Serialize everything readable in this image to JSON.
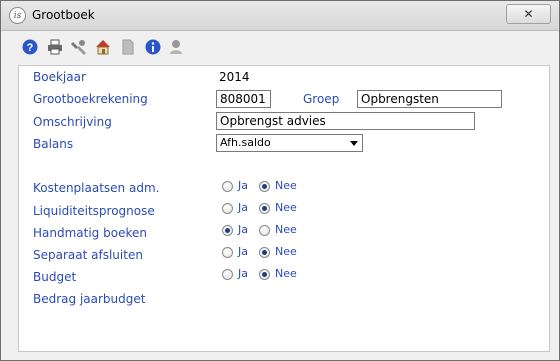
{
  "window": {
    "title": "Grootboek",
    "logo_text": "is",
    "close_glyph": "✕"
  },
  "toolbar": {
    "icons": [
      "help-icon",
      "print-icon",
      "tools-icon",
      "home-icon",
      "document-icon",
      "info-icon",
      "user-icon"
    ]
  },
  "form": {
    "boekjaar": {
      "label": "Boekjaar",
      "value": "2014"
    },
    "grootboekrekening": {
      "label": "Grootboekrekening",
      "value": "808001"
    },
    "groep": {
      "label": "Groep",
      "value": "Opbrengsten"
    },
    "omschrijving": {
      "label": "Omschrijving",
      "value": "Opbrengst advies"
    },
    "balans": {
      "label": "Balans",
      "value": "Afh.saldo"
    },
    "options": [
      {
        "label": "Kostenplaatsen  adm.",
        "ja": "Ja",
        "nee": "Nee",
        "selected": "Nee"
      },
      {
        "label": "Liquiditeitsprognose",
        "ja": "Ja",
        "nee": "Nee",
        "selected": "Nee"
      },
      {
        "label": "Handmatig boeken",
        "ja": "Ja",
        "nee": "Nee",
        "selected": "Ja"
      },
      {
        "label": "Separaat afsluiten",
        "ja": "Ja",
        "nee": "Nee",
        "selected": "Nee"
      },
      {
        "label": "Budget",
        "ja": "Ja",
        "nee": "Nee",
        "selected": "Nee"
      }
    ],
    "bedrag_jaarbudget": {
      "label": "Bedrag jaarbudget"
    }
  },
  "colors": {
    "label": "#2b4bb5",
    "radio_dot": "#1d3f7a",
    "help_icon": "#2a56c6",
    "info_icon": "#2a56c6"
  }
}
